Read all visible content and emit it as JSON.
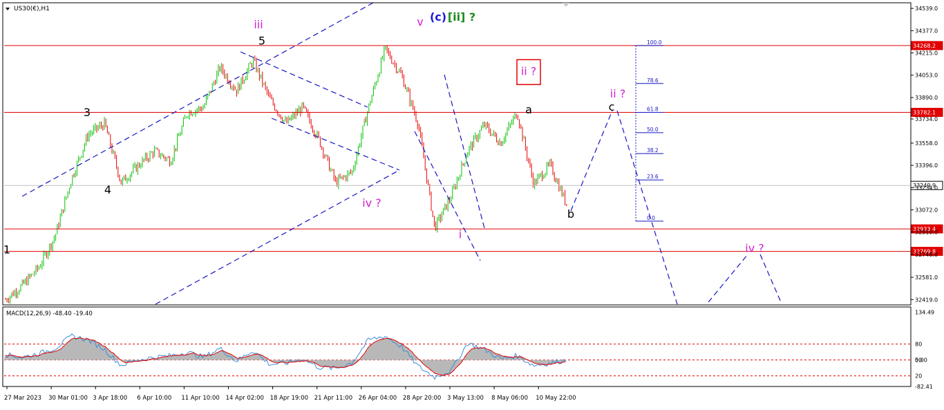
{
  "header": {
    "symbol": "US30(€),H1"
  },
  "colors": {
    "up": "#00c000",
    "down": "#e60000",
    "channel": "#1515c0",
    "level": "#e00000",
    "wave_black": "#000000",
    "wave_magenta": "#d21fd2",
    "wave_blue": "#1a1ad6",
    "wave_green": "#1e8a1e",
    "histogram": "#b8b8b8",
    "macd_line": "#3a8fd8",
    "signal_line": "#e00000"
  },
  "chart_data": [
    {
      "type": "candlestick",
      "title": "US30(€),H1",
      "ylim": [
        32380,
        34580
      ],
      "y_ticks": [
        "34539.0",
        "34377.0",
        "34215.0",
        "34053.0",
        "33890.0",
        "33734.0",
        "33558.0",
        "33396.0",
        "33234.0",
        "33072.0",
        "32910.0",
        "32748.0",
        "32581.0",
        "32419.0"
      ],
      "x_ticks": [
        "27 Mar 2023",
        "30 Mar 01:00",
        "3 Apr 18:00",
        "6 Apr 10:00",
        "11 Apr 10:00",
        "14 Apr 02:00",
        "18 Apr 19:00",
        "21 Apr 11:00",
        "26 Apr 04:00",
        "28 Apr 20:00",
        "3 May 13:00",
        "8 May 06:00",
        "10 May 22:00"
      ],
      "price_path": [
        {
          "x": "27 Mar 2023",
          "y": 32419
        },
        {
          "x": "28 Mar",
          "y": 32520
        },
        {
          "x": "29 Mar",
          "y": 32650
        },
        {
          "x": "30 Mar 01:00",
          "y": 32880
        },
        {
          "x": "31 Mar",
          "y": 33300
        },
        {
          "x": "2 Apr",
          "y": 33620
        },
        {
          "x": "3 Apr 18:00",
          "y": 33700
        },
        {
          "x": "4 Apr",
          "y": 33270
        },
        {
          "x": "5 Apr",
          "y": 33390
        },
        {
          "x": "6 Apr 10:00",
          "y": 33500
        },
        {
          "x": "10 Apr",
          "y": 33430
        },
        {
          "x": "11 Apr 10:00",
          "y": 33780
        },
        {
          "x": "12 Apr",
          "y": 33820
        },
        {
          "x": "13 Apr",
          "y": 34110
        },
        {
          "x": "14 Apr 02:00",
          "y": 33940
        },
        {
          "x": "17 Apr",
          "y": 34160
        },
        {
          "x": "18 Apr 19:00",
          "y": 33880
        },
        {
          "x": "20 Apr",
          "y": 33700
        },
        {
          "x": "21 Apr 11:00",
          "y": 33820
        },
        {
          "x": "24 Apr",
          "y": 33580
        },
        {
          "x": "25 Apr",
          "y": 33270
        },
        {
          "x": "26 Apr 04:00",
          "y": 33350
        },
        {
          "x": "27 Apr",
          "y": 33820
        },
        {
          "x": "28 Apr 20:00",
          "y": 34245
        },
        {
          "x": "1 May",
          "y": 34050
        },
        {
          "x": "2 May",
          "y": 33700
        },
        {
          "x": "3 May 13:00",
          "y": 32940
        },
        {
          "x": "4 May",
          "y": 33170
        },
        {
          "x": "5 May",
          "y": 33500
        },
        {
          "x": "8 May 06:00",
          "y": 33690
        },
        {
          "x": "9 May",
          "y": 33560
        },
        {
          "x": "9 May 22:00",
          "y": 33782
        },
        {
          "x": "10 May",
          "y": 33260
        },
        {
          "x": "10 May 22:00",
          "y": 33400
        },
        {
          "x": "11 May",
          "y": 33110
        }
      ],
      "horizontal_levels": [
        "34268.2",
        "33782.1",
        "33249.9",
        "32933.4",
        "32769.8"
      ],
      "current_price": "33249.9",
      "fibonacci_levels": [
        {
          "label": "100.0",
          "price": 34268.2
        },
        {
          "label": "78.6",
          "price": 33992
        },
        {
          "label": "61.8",
          "price": 33782
        },
        {
          "label": "50.0",
          "price": 33634
        },
        {
          "label": "38.2",
          "price": 33482
        },
        {
          "label": "23.6",
          "price": 33290
        },
        {
          "label": "0.0",
          "price": 32990
        }
      ],
      "wave_labels": [
        {
          "text": "1",
          "price": 32780,
          "color": "wave_black"
        },
        {
          "text": "3",
          "price": 33780,
          "color": "wave_black"
        },
        {
          "text": "4",
          "price": 33215,
          "color": "wave_black"
        },
        {
          "text": "5",
          "price": 34300,
          "color": "wave_black"
        },
        {
          "text": "iii",
          "price": 34420,
          "color": "wave_magenta"
        },
        {
          "text": "iv ?",
          "price": 33120,
          "color": "wave_magenta"
        },
        {
          "text": "v",
          "price": 34440,
          "color": "wave_magenta"
        },
        {
          "text": "(c)",
          "price": 34475,
          "color": "wave_blue"
        },
        {
          "text": "[ii] ?",
          "price": 34475,
          "color": "wave_green"
        },
        {
          "text": "ii ?",
          "price": 34080,
          "color": "wave_magenta"
        },
        {
          "text": "a",
          "price": 33800,
          "color": "wave_black"
        },
        {
          "text": "ii ?",
          "price": 33915,
          "color": "wave_magenta"
        },
        {
          "text": "c",
          "price": 33820,
          "color": "wave_black"
        },
        {
          "text": "b",
          "price": 33040,
          "color": "wave_black"
        },
        {
          "text": "i",
          "price": 32890,
          "color": "wave_magenta"
        },
        {
          "text": "iv ?",
          "price": 32790,
          "color": "wave_magenta"
        }
      ]
    },
    {
      "type": "line",
      "title": "MACD(12,26,9) -48.40 -19.40",
      "ylim": [
        0,
        150
      ],
      "y_ticks": [
        "134.49",
        "80",
        "50",
        "0.00",
        "20",
        "-82.41"
      ],
      "levels": [
        80,
        50,
        20
      ],
      "macd_path": [
        {
          "x": "27 Mar 2023",
          "y": 60
        },
        {
          "x": "28 Mar",
          "y": 55
        },
        {
          "x": "29 Mar",
          "y": 62
        },
        {
          "x": "30 Mar 01:00",
          "y": 72
        },
        {
          "x": "31 Mar",
          "y": 95
        },
        {
          "x": "2 Apr",
          "y": 88
        },
        {
          "x": "3 Apr 18:00",
          "y": 70
        },
        {
          "x": "4 Apr",
          "y": 40
        },
        {
          "x": "5 Apr",
          "y": 50
        },
        {
          "x": "6 Apr 10:00",
          "y": 55
        },
        {
          "x": "10 Apr",
          "y": 58
        },
        {
          "x": "11 Apr 10:00",
          "y": 65
        },
        {
          "x": "12 Apr",
          "y": 55
        },
        {
          "x": "13 Apr",
          "y": 72
        },
        {
          "x": "14 Apr 02:00",
          "y": 48
        },
        {
          "x": "17 Apr",
          "y": 68
        },
        {
          "x": "18 Apr 19:00",
          "y": 42
        },
        {
          "x": "20 Apr",
          "y": 44
        },
        {
          "x": "21 Apr 11:00",
          "y": 52
        },
        {
          "x": "24 Apr",
          "y": 36
        },
        {
          "x": "25 Apr",
          "y": 34
        },
        {
          "x": "26 Apr 04:00",
          "y": 45
        },
        {
          "x": "27 Apr",
          "y": 88
        },
        {
          "x": "28 Apr 20:00",
          "y": 95
        },
        {
          "x": "1 May",
          "y": 75
        },
        {
          "x": "2 May",
          "y": 38
        },
        {
          "x": "3 May 13:00",
          "y": 18
        },
        {
          "x": "4 May",
          "y": 30
        },
        {
          "x": "5 May",
          "y": 82
        },
        {
          "x": "8 May 06:00",
          "y": 70
        },
        {
          "x": "9 May",
          "y": 52
        },
        {
          "x": "9 May 22:00",
          "y": 58
        },
        {
          "x": "10 May",
          "y": 40
        },
        {
          "x": "10 May 22:00",
          "y": 44
        },
        {
          "x": "11 May",
          "y": 50
        }
      ]
    }
  ]
}
